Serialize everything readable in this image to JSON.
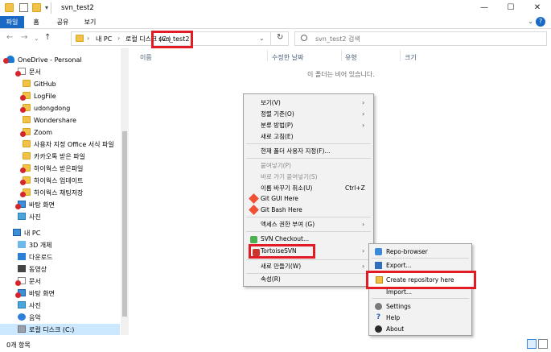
{
  "window": {
    "title": "svn_test2",
    "minimize": "—",
    "maximize": "☐",
    "close": "✕"
  },
  "ribbon": {
    "tabs": [
      "파일",
      "홈",
      "공유",
      "보기"
    ],
    "expand": "⌄",
    "help": "?"
  },
  "nav": {
    "back": "←",
    "forward": "→",
    "recent": "⌄",
    "up": "↑",
    "refresh": "↻",
    "dropdown": "⌄"
  },
  "address": {
    "crumbs": [
      "내 PC",
      "로컬 디스크 (C:)",
      "svn_test2"
    ],
    "separator": "›"
  },
  "search": {
    "placeholder": "svn_test2 검색"
  },
  "tree": [
    "OneDrive - Personal",
    "문서",
    "GitHub",
    "LogFile",
    "udongdong",
    "Wondershare",
    "Zoom",
    "사용자 지정 Office 서식 파일",
    "카카오톡 받은 파일",
    "하이웍스 받은파일",
    "하이웍스 업데이트",
    "하이웍스 채팅저장",
    "바탕 화면",
    "사진",
    "내 PC",
    "3D 개체",
    "다운로드",
    "동영상",
    "문서",
    "바탕 화면",
    "사진",
    "음악",
    "로컬 디스크 (C:)"
  ],
  "columns": [
    "이름",
    "수정한 날짜",
    "유형",
    "크기"
  ],
  "empty_message": "이 폴더는 비어 있습니다.",
  "status": {
    "items": "0개 항목"
  },
  "context_menu": {
    "items": [
      "보기(V)",
      "정렬 기준(O)",
      "분류 방법(P)",
      "새로 고침(E)",
      "현재 폴더 사용자 지정(F)...",
      "붙여넣기(P)",
      "바로 가기 붙여넣기(S)",
      "이름 바꾸기 취소(U)",
      "Git GUI Here",
      "Git Bash Here",
      "액세스 권한 부여 (G)",
      "SVN Checkout...",
      "TortoiseSVN",
      "새로 만들기(W)",
      "속성(R)"
    ],
    "undo_shortcut": "Ctrl+Z",
    "arrow": "›"
  },
  "submenu": {
    "items": [
      "Repo-browser",
      "Export...",
      "Create repository here",
      "Import...",
      "Settings",
      "Help",
      "About"
    ],
    "help_glyph": "?"
  }
}
